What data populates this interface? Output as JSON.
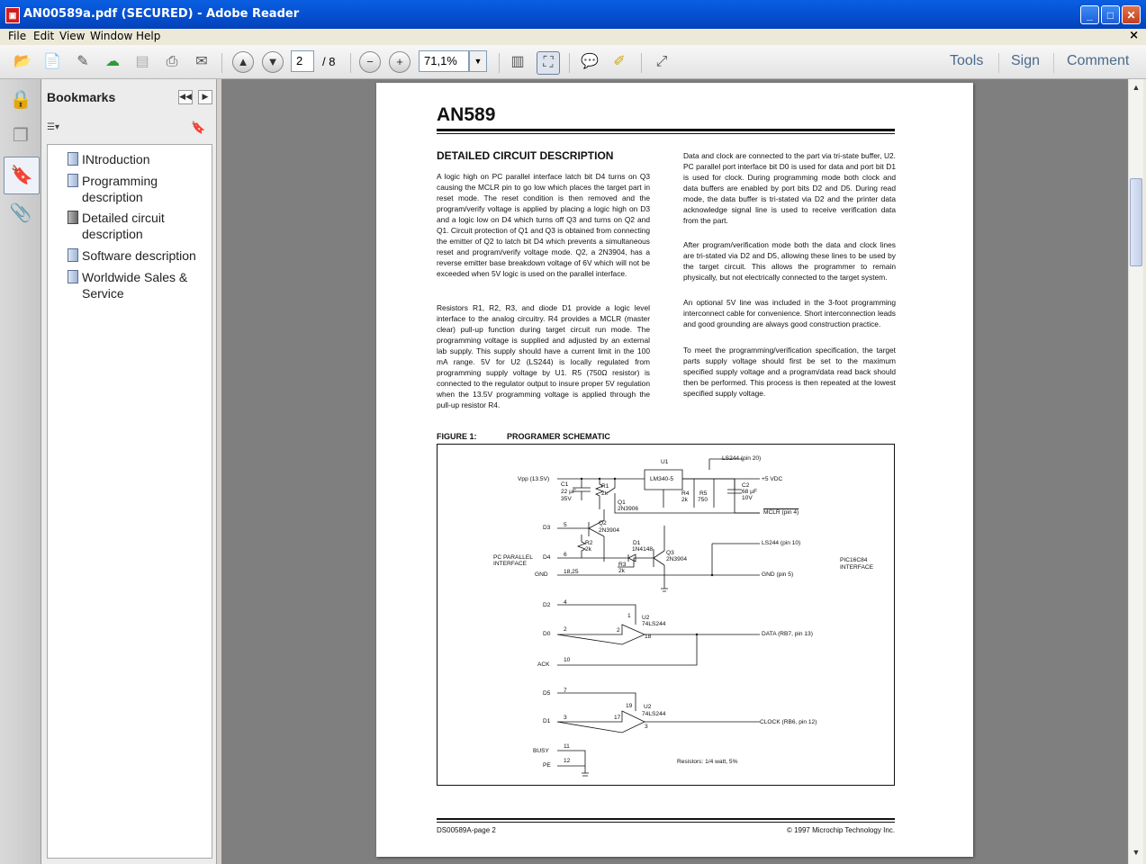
{
  "window": {
    "title": "AN00589a.pdf (SECURED) - Adobe Reader",
    "app_icon": "pdf-icon",
    "close_glyph": "×"
  },
  "menu": [
    "File",
    "Edit",
    "View",
    "Window",
    "Help"
  ],
  "toolbar": {
    "page_current": "2",
    "page_total": "/ 8",
    "zoom": "71,1%",
    "right_links": [
      "Tools",
      "Sign",
      "Comment"
    ]
  },
  "bookmarks": {
    "header": "Bookmarks",
    "items": [
      {
        "label": "INtroduction"
      },
      {
        "label": "Programming description"
      },
      {
        "label": "Detailed circuit description"
      },
      {
        "label": "Software description"
      },
      {
        "label": "Worldwide Sales & Service"
      }
    ]
  },
  "doc": {
    "heading": "AN589",
    "section_title": "DETAILED CIRCUIT DESCRIPTION",
    "left_paragraphs": [
      "A logic high on PC parallel interface latch bit D4 turns on Q3 causing the MCLR pin to go low which places the target part in reset mode. The reset condition is then removed and the program/verify voltage is applied by placing a logic high on D3 and a logic low on D4 which turns off Q3 and turns on Q2 and Q1. Circuit protection of Q1 and Q3 is obtained from connecting the emitter of Q2 to latch bit D4 which prevents a simultaneous reset and program/verify voltage mode. Q2, a 2N3904, has a reverse emitter base breakdown voltage of 6V which will not be exceeded when 5V logic is used on the parallel interface.",
      "Resistors R1, R2, R3, and diode D1 provide a logic level interface to the analog circuitry. R4 provides a MCLR (master clear) pull-up function during target circuit run mode. The programming voltage is supplied and adjusted by an external lab supply. This supply should have a current limit in the 100 mA range. 5V for U2 (LS244) is locally regulated from programming supply voltage by U1. R5 (750Ω resistor) is connected to the regulator output to insure proper 5V regulation when the 13.5V programming voltage is applied through the pull-up resistor R4."
    ],
    "right_paragraphs": [
      "Data and clock are connected to the part via tri-state buffer, U2. PC parallel port interface bit D0 is used for data and port bit D1 is used for clock. During programming mode both clock and data buffers are enabled by port bits D2 and D5. During read mode, the data buffer is tri-stated via D2 and the printer data acknowledge signal line is used to receive verification data from the part.",
      "After program/verification mode both the data and clock lines are tri-stated via D2 and D5, allowing these lines to be used by the target circuit. This allows the programmer to remain physically, but not electrically connected to the target system.",
      "An optional 5V line was included in the 3-foot programming interconnect cable for convenience. Short interconnection leads and good grounding are always good construction practice.",
      "To meet the programming/verification specification, the target parts supply voltage should first be set to the maximum specified supply voltage and a program/data read back should then be performed. This process is then repeated at the lowest specified supply voltage."
    ],
    "figure_label": "FIGURE 1:",
    "figure_title": "PROGRAMER SCHEMATIC",
    "footer_left": "DS00589A-page 2",
    "footer_right": "© 1997 Microchip Technology Inc.",
    "schematic": {
      "labels": {
        "vpp": "Vpp (13.5V)",
        "c1": "C1",
        "c1v": "22 µF",
        "c1r": "35V",
        "r1": "R1",
        "r1v": "2k",
        "u1": "U1",
        "u1p": "LM340-5",
        "ls244_20": "LS244  (pin 20)",
        "vdc": "+5 VDC",
        "r4": "R4",
        "r4v": "2k",
        "r5": "R5",
        "r5v": "750",
        "c2": "C2",
        "c2v": "68 µF",
        "c2r": "10V",
        "q1": "Q1",
        "q1p": "2N3906",
        "mclr": "MCLR  (pin 4)",
        "d3": "D3",
        "q2": "Q2",
        "q2p": "2N3904",
        "n5": "5",
        "r2": "R2",
        "r2v": "2k",
        "d1": "D1",
        "d1p": "1N4148",
        "pcpi": "PC PARALLEL",
        "pcpi2": "INTERFACE",
        "d4": "D4",
        "n6": "6",
        "q3": "Q3",
        "q3p": "2N3904",
        "ls244_10": "LS244  (pin 10)",
        "r3": "R3",
        "r3v": "2k",
        "gnd": "GND",
        "n1825": "18,25",
        "gndp": "GND  (pin 5)",
        "pic": "PIC16C84",
        "pic2": "INTERFACE",
        "d2": "D2",
        "n4": "4",
        "n1": "1",
        "u2": "U2",
        "u2p": "74LS244",
        "d0": "D0",
        "n2": "2",
        "n2b": "2",
        "n18": "18",
        "data": "DATA  (RB7, pin 13)",
        "ack": "ACK",
        "n10": "10",
        "d5": "D5",
        "n7": "7",
        "n19": "19",
        "u2b": "U2",
        "u2bp": "74LS244",
        "d1n": "D1",
        "n3": "3",
        "n17": "17",
        "n3b": "3",
        "clock": "CLOCK  (RB6, pin 12)",
        "busy": "BUSY",
        "n11": "11",
        "pe": "PE",
        "n12": "12",
        "resistors": "Resistors: 1/4 watt, 5%"
      }
    }
  }
}
